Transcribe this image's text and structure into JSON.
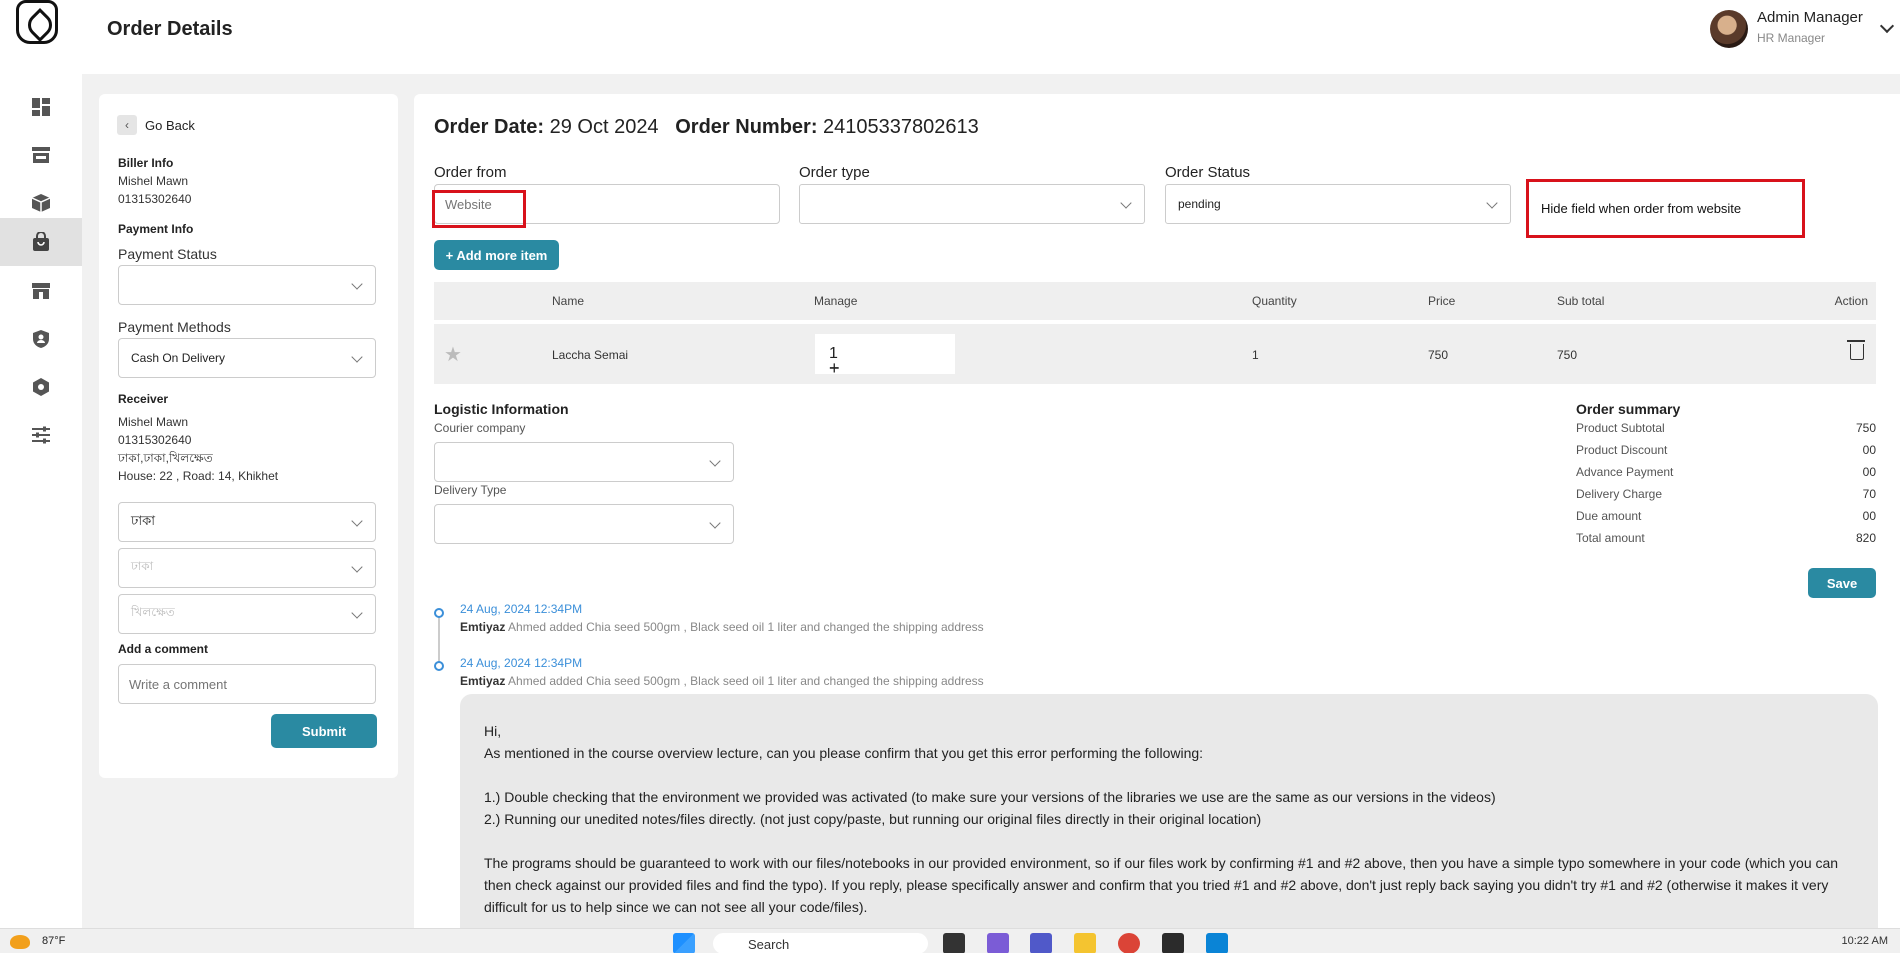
{
  "header": {
    "title": "Order Details",
    "user_name": "Admin Manager",
    "user_role": "HR Manager"
  },
  "sidebar": {
    "icons": [
      "dashboard-icon",
      "store-icon",
      "box-icon",
      "shopping-bag-icon",
      "shop-icon",
      "user-shield-icon",
      "settings-hex-icon",
      "sliders-icon"
    ],
    "active_index": 3
  },
  "left": {
    "go_back": "Go Back",
    "biller_title": "Biller Info",
    "biller_name": "Mishel Mawn",
    "biller_phone": "01315302640",
    "payment_title": "Payment Info",
    "payment_status_label": "Payment Status",
    "payment_status_value": "",
    "payment_methods_label": "Payment Methods",
    "payment_methods_value": "Cash On Delivery",
    "receiver_title": "Receiver",
    "receiver_name": "Mishel Mawn",
    "receiver_phone": "01315302640",
    "receiver_area": "ঢাকা,ঢাকা,খিলক্ষেত",
    "receiver_address": "House: 22 , Road: 14, Khikhet",
    "division_value": "ঢাকা",
    "district_placeholder": "ঢাকা",
    "area_placeholder": "খিলক্ষেত",
    "comment_label": "Add a comment",
    "comment_placeholder": "Write a comment",
    "submit": "Submit"
  },
  "order": {
    "date_label": "Order Date:",
    "date_value": "29 Oct 2024",
    "number_label": "Order Number:",
    "number_value": "24105337802613",
    "from_label": "Order from",
    "from_placeholder": "Website",
    "type_label": "Order type",
    "type_value": "",
    "status_label": "Order Status",
    "status_value": "pending",
    "annotation": "Hide field when order from website",
    "add_item": "+ Add more item"
  },
  "table": {
    "headers": {
      "name": "Name",
      "manage": "Manage",
      "quantity": "Quantity",
      "price": "Price",
      "subtotal": "Sub total",
      "action": "Action"
    },
    "rows": [
      {
        "name": "Laccha Semai",
        "qty_stepper": "1",
        "quantity": "1",
        "price": "750",
        "subtotal": "750"
      }
    ]
  },
  "logistic": {
    "title": "Logistic Information",
    "courier_label": "Courier company",
    "delivery_label": "Delivery Type"
  },
  "summary": {
    "title": "Order summary",
    "items": [
      {
        "label": "Product Subtotal",
        "value": "750"
      },
      {
        "label": "Product Discount",
        "value": "00"
      },
      {
        "label": "Advance Payment",
        "value": "00"
      },
      {
        "label": "Delivery Charge",
        "value": "70"
      },
      {
        "label": "Due amount",
        "value": "00"
      },
      {
        "label": "Total amount",
        "value": "820"
      }
    ],
    "save": "Save"
  },
  "timeline": [
    {
      "date": "24 Aug, 2024 12:34PM",
      "user": "Emtiyaz",
      "text": "Ahmed added Chia seed 500gm , Black seed oil 1 liter and changed the shipping address"
    },
    {
      "date": "24 Aug, 2024 12:34PM",
      "user": "Emtiyaz",
      "text": "Ahmed added Chia seed 500gm , Black seed oil 1 liter and changed the shipping address"
    }
  ],
  "comment": {
    "greeting": "Hi,",
    "line1": "As mentioned in the course overview lecture, can you please confirm that you get this error performing the following:",
    "step1": "1.) Double checking that the environment we provided was activated (to make sure your versions of the libraries we use are the same as our versions in the videos)",
    "step2": "2.) Running our unedited notes/files directly. (not just copy/paste, but running our original files directly in their original location)",
    "para": "The programs should be guaranteed to work with our files/notebooks in our provided environment, so if our files work by confirming #1 and #2 above, then you have a simple typo somewhere in your code (which you can then check against our provided files and find the typo). If you reply, please specifically answer and confirm that you tried #1 and #2 above, don't just reply back saying you didn't try #1 and #2 (otherwise it makes it very difficult for us to help since we can not see all your code/files)."
  },
  "taskbar": {
    "temp": "87°F",
    "search": "Search",
    "time": "10:22 AM"
  }
}
